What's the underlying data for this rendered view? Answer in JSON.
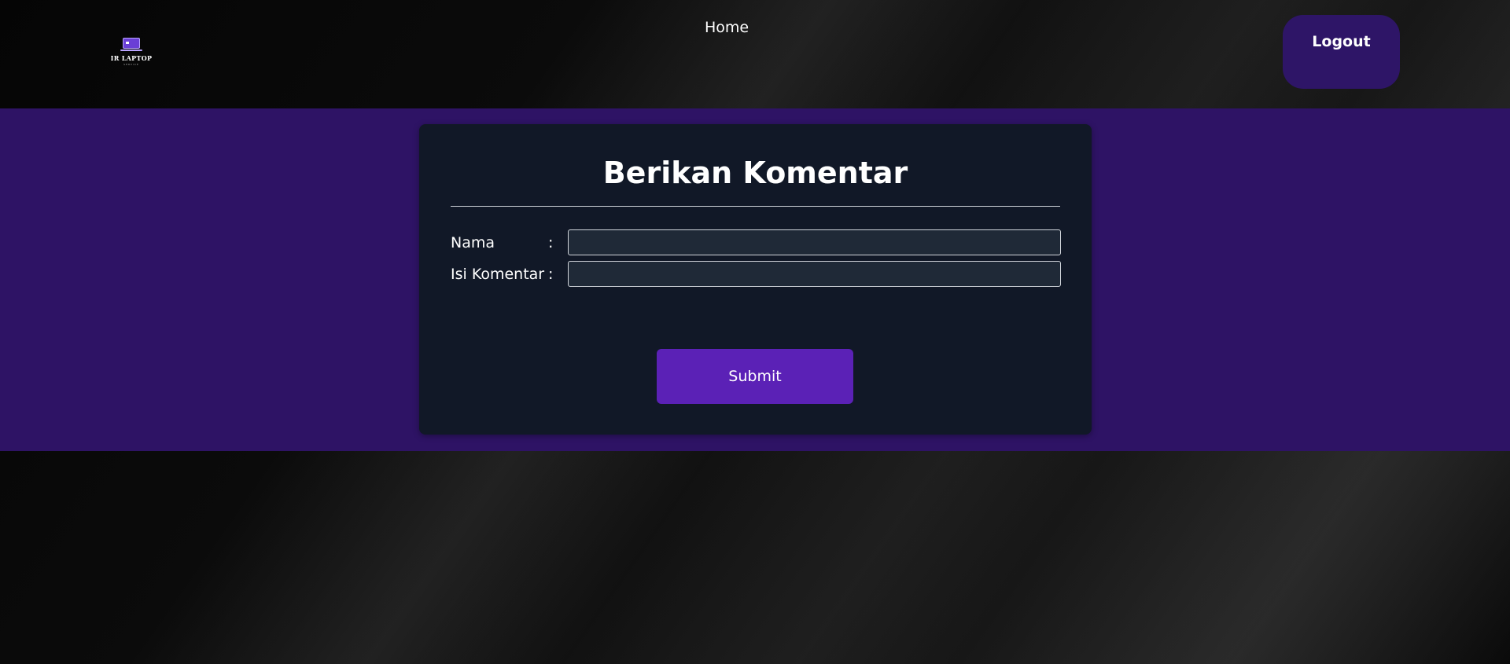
{
  "header": {
    "logo": {
      "icon": "laptop-icon",
      "text": "IR LAPTOP",
      "subtext": "SERVICE"
    },
    "nav": {
      "home_label": "Home"
    },
    "logout_label": "Logout"
  },
  "form": {
    "title": "Berikan Komentar",
    "fields": [
      {
        "label": "Nama",
        "colon": ":",
        "value": "",
        "placeholder": ""
      },
      {
        "label": "Isi Komentar",
        "colon": ":",
        "value": "",
        "placeholder": ""
      }
    ],
    "submit_label": "Submit"
  },
  "colors": {
    "band": "#2e1365",
    "card": "#111827",
    "input_bg": "#1f2937",
    "submit": "#5b21b6",
    "logout": "#2e1567"
  }
}
